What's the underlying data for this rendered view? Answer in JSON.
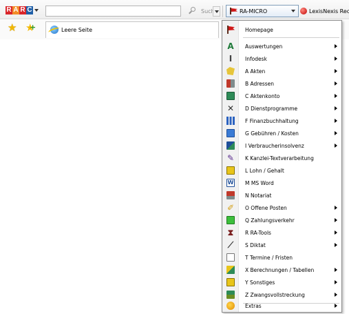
{
  "toolbar": {
    "logo": {
      "letters": [
        "R",
        "A",
        "R",
        "C"
      ],
      "colors": [
        "#d9252a",
        "#f28c28",
        "#d9252a",
        "#1f5fa8"
      ]
    },
    "address_value": "",
    "search_label": "Suche",
    "ra_button_label": "RA-MICRO",
    "lexis_label": "LexisNexis Rec"
  },
  "tab": {
    "label": "Leere Seite"
  },
  "menu": {
    "top": {
      "label": "Homepage",
      "icon": "flag-icon"
    },
    "items": [
      {
        "label": "Auswertungen",
        "icon": "letter-a-icon",
        "submenu": true
      },
      {
        "label": "Infodesk",
        "icon": "info-pillar-icon",
        "submenu": true
      },
      {
        "label": "A Akten",
        "icon": "folder-icon",
        "submenu": true
      },
      {
        "label": "B Adressen",
        "icon": "address-book-icon",
        "submenu": true
      },
      {
        "label": "C Aktenkonto",
        "icon": "ledger-icon",
        "submenu": true
      },
      {
        "label": "D Dienstprogramme",
        "icon": "tools-icon",
        "submenu": true
      },
      {
        "label": "F Finanzbuchhaltung",
        "icon": "bar-chart-icon",
        "submenu": true
      },
      {
        "label": "G Gebühren / Kosten",
        "icon": "calculator-icon",
        "submenu": true
      },
      {
        "label": "I Verbraucherinsolvenz",
        "icon": "insolvency-icon",
        "submenu": true
      },
      {
        "label": "K Kanzlei-Textverarbeitung",
        "icon": "pen-icon",
        "submenu": false
      },
      {
        "label": "L Lohn / Gehalt",
        "icon": "payroll-icon",
        "submenu": false
      },
      {
        "label": "M MS Word",
        "icon": "word-icon",
        "submenu": false
      },
      {
        "label": "N Notariat",
        "icon": "notary-icon",
        "submenu": false
      },
      {
        "label": "O Offene Posten",
        "icon": "open-items-icon",
        "submenu": true
      },
      {
        "label": "Q Zahlungsverkehr",
        "icon": "payment-icon",
        "submenu": true
      },
      {
        "label": "R RA-Tools",
        "icon": "ra-tools-icon",
        "submenu": true
      },
      {
        "label": "S Diktat",
        "icon": "microphone-icon",
        "submenu": true
      },
      {
        "label": "T Termine / Fristen",
        "icon": "calendar-icon",
        "submenu": false
      },
      {
        "label": "X Berechnungen / Tabellen",
        "icon": "calculation-icon",
        "submenu": true
      },
      {
        "label": "Y Sonstiges",
        "icon": "misc-icon",
        "submenu": true
      },
      {
        "label": "Z Zwangsvollstreckung",
        "icon": "enforcement-icon",
        "submenu": true
      }
    ],
    "bottom": {
      "label": "Extras",
      "icon": "extras-icon",
      "submenu": true
    }
  }
}
